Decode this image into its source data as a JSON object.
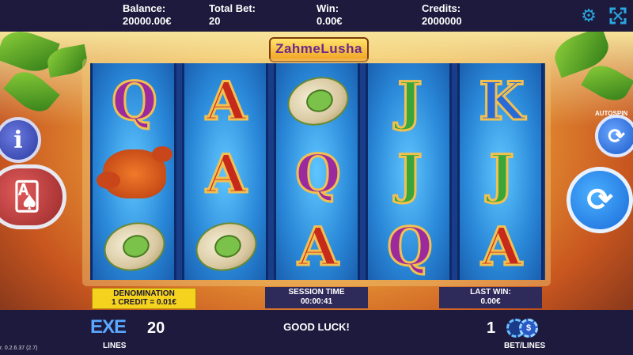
{
  "header": {
    "balance_label": "Balance:",
    "balance_value": "20000.00€",
    "total_bet_label": "Total Bet:",
    "total_bet_value": "20",
    "win_label": "Win:",
    "win_value": "0.00€",
    "credits_label": "Credits:",
    "credits_value": "2000000",
    "settings_icon": "gear-icon",
    "fullscreen_icon": "fullscreen-icon"
  },
  "game": {
    "logo_text": "ZahmeLusha",
    "reels": [
      [
        "Q",
        "lobster",
        "pistachio"
      ],
      [
        "A",
        "A",
        "pistachio"
      ],
      [
        "pistachio",
        "Q",
        "A"
      ],
      [
        "J",
        "J",
        "Q"
      ],
      [
        "K",
        "J",
        "A"
      ]
    ]
  },
  "side_controls": {
    "info_icon": "info-icon",
    "paytable_icon": "cards-icon",
    "autospin_label": "AUTOSPIN",
    "autospin_icon": "autospin-icon",
    "spin_icon": "spin-icon"
  },
  "info_boxes": {
    "denomination_title": "DENOMINATION",
    "denomination_value": "1 CREDIT = 0.01€",
    "session_time_label": "SESSION TIME",
    "session_time_value": "00:00:41",
    "last_win_label": "LAST WIN:",
    "last_win_value": "0.00€"
  },
  "footer": {
    "lines_logo": "EXE",
    "lines_value": "20",
    "lines_label": "LINES",
    "message": "GOOD LUCK!",
    "bet_value": "1",
    "bet_label": "BET/LINES",
    "version": "r. 0.2.6.37 (2.7)"
  },
  "colors": {
    "bar_bg": "#1d1a3d",
    "accent_blue": "#2aa6e0",
    "denomination_bg": "#f5d21e"
  }
}
